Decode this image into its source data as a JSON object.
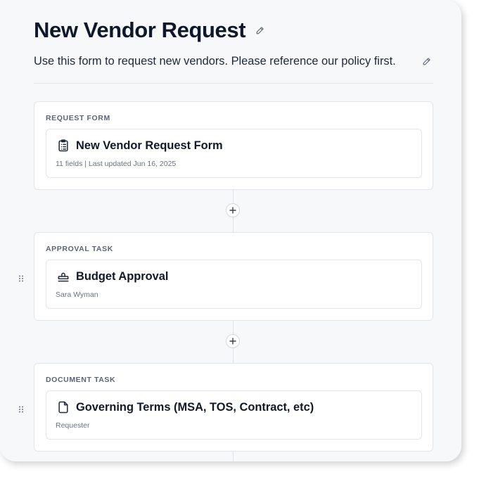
{
  "header": {
    "title": "New Vendor Request",
    "description": "Use this form to request new vendors. Please reference our policy first."
  },
  "workflow": {
    "steps": [
      {
        "section_label": "REQUEST FORM",
        "title": "New Vendor Request Form",
        "subtitle": "11 fields | Last updated Jun 16, 2025",
        "icon": "clipboard-list-icon"
      },
      {
        "section_label": "APPROVAL TASK",
        "title": "Budget Approval",
        "subtitle": "Sara Wyman",
        "icon": "stamp-icon"
      },
      {
        "section_label": "DOCUMENT TASK",
        "title": "Governing Terms (MSA, TOS, Contract, etc)",
        "subtitle": "Requester",
        "icon": "document-icon"
      }
    ]
  },
  "colors": {
    "panel_background": "#f7f8fa",
    "card_border": "#e2e5e9",
    "label_text": "#5b6475"
  }
}
